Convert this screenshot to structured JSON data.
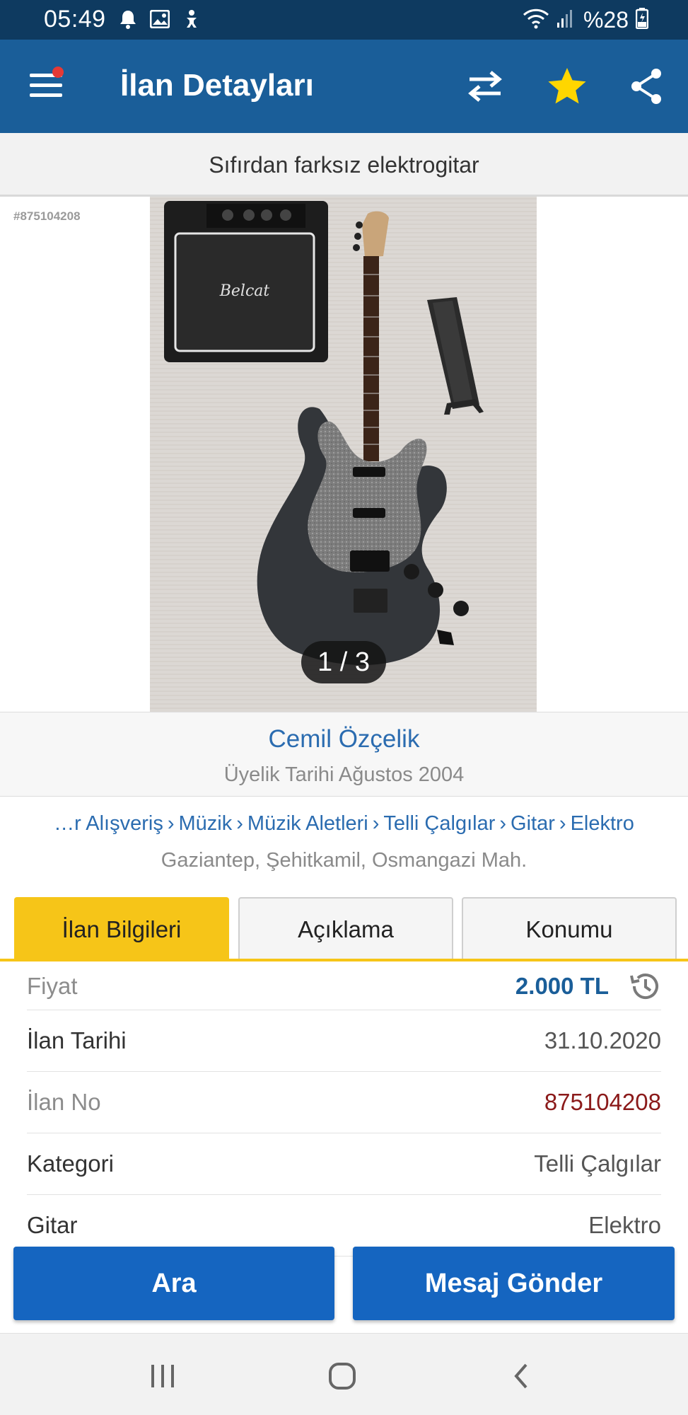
{
  "status_bar": {
    "time": "05:49",
    "icons": [
      "notification-bell-icon",
      "image-icon",
      "accessibility-icon",
      "wifi-icon",
      "signal-icon",
      "battery-icon"
    ],
    "battery": "%28"
  },
  "app_bar": {
    "title": "İlan Detayları",
    "icons": [
      "menu-icon",
      "compare-icon",
      "favorite-star-icon",
      "share-icon"
    ],
    "star_color": "#ffd600"
  },
  "listing": {
    "title": "Sıfırdan farksız elektrogitar",
    "ad_number_tag": "#875104208",
    "photo_counter": "1 / 3",
    "amp_brand": "Belcat"
  },
  "seller": {
    "name": "Cemil Özçelik",
    "member_since": "Üyelik Tarihi  Ağustos 2004"
  },
  "breadcrumb": {
    "items": [
      "…r Alışveriş",
      "Müzik",
      "Müzik Aletleri",
      "Telli Çalgılar",
      "Gitar",
      "Elektro"
    ],
    "location": "Gaziantep, Şehitkamil, Osmangazi Mah."
  },
  "tabs": [
    {
      "label": "İlan Bilgileri",
      "active": true
    },
    {
      "label": "Açıklama",
      "active": false
    },
    {
      "label": "Konumu",
      "active": false
    }
  ],
  "details": [
    {
      "key": "Fiyat",
      "value": "2.000 TL"
    },
    {
      "key": "İlan Tarihi",
      "value": "31.10.2020"
    },
    {
      "key": "İlan No",
      "value": "875104208"
    },
    {
      "key": "Kategori",
      "value": "Telli Çalgılar"
    },
    {
      "key": "Gitar",
      "value": "Elektro"
    }
  ],
  "actions": {
    "call": "Ara",
    "message": "Mesaj Gönder"
  },
  "colors": {
    "header": "#1a5e99",
    "status_bar": "#0e3a60",
    "accent_tab": "#f6c518",
    "button": "#1565c0",
    "link": "#2b6cb0"
  },
  "nav_bar": {
    "icons": [
      "recent-apps-icon",
      "home-icon",
      "back-icon"
    ]
  }
}
